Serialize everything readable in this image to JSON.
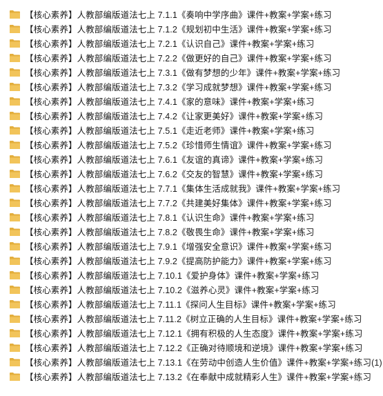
{
  "folder_icon": "folder-icon",
  "folder_color": "#F2C45A",
  "items": [
    "【核心素养】人教部编版道法七上 7.1.1《奏响中学序曲》课件+教案+学案+练习",
    "【核心素养】人教部编版道法七上 7.1.2《规划初中生活》课件+教案+学案+练习",
    "【核心素养】人教部编版道法七上 7.2.1《认识自己》课件+教案+学案+练习",
    "【核心素养】人教部编版道法七上 7.2.2《做更好的自己》课件+教案+学案+练习",
    "【核心素养】人教部编版道法七上 7.3.1《做有梦想的少年》课件+教案+学案+练习",
    "【核心素养】人教部编版道法七上 7.3.2《学习成就梦想》课件+教案+学案+练习",
    "【核心素养】人教部编版道法七上 7.4.1《家的意味》课件+教案+学案+练习",
    "【核心素养】人教部编版道法七上 7.4.2《让家更美好》课件+教案+学案+练习",
    "【核心素养】人教部编版道法七上 7.5.1《走近老师》课件+教案+学案+练习",
    "【核心素养】人教部编版道法七上 7.5.2《珍惜师生情谊》课件+教案+学案+练习",
    "【核心素养】人教部编版道法七上 7.6.1《友谊的真谛》课件+教案+学案+练习",
    "【核心素养】人教部编版道法七上 7.6.2《交友的智慧》课件+教案+学案+练习",
    "【核心素养】人教部编版道法七上 7.7.1《集体生活成就我》课件+教案+学案+练习",
    "【核心素养】人教部编版道法七上 7.7.2《共建美好集体》课件+教案+学案+练习",
    "【核心素养】人教部编版道法七上 7.8.1《认识生命》课件+教案+学案+练习",
    "【核心素养】人教部编版道法七上 7.8.2《敬畏生命》课件+教案+学案+练习",
    "【核心素养】人教部编版道法七上 7.9.1《增强安全意识》课件+教案+学案+练习",
    "【核心素养】人教部编版道法七上 7.9.2《提高防护能力》课件+教案+学案+练习",
    "【核心素养】人教部编版道法七上 7.10.1《爱护身体》课件+教案+学案+练习",
    "【核心素养】人教部编版道法七上 7.10.2《滋养心灵》课件+教案+学案+练习",
    "【核心素养】人教部编版道法七上 7.11.1《探问人生目标》课件+教案+学案+练习",
    "【核心素养】人教部编版道法七上 7.11.2《树立正确的人生目标》课件+教案+学案+练习",
    "【核心素养】人教部编版道法七上 7.12.1《拥有积极的人生态度》课件+教案+学案+练习",
    "【核心素养】人教部编版道法七上 7.12.2《正确对待顺境和逆境》课件+教案+学案+练习",
    "【核心素养】人教部编版道法七上 7.13.1《在劳动中创造人生价值》课件+教案+学案+练习(1)",
    "【核心素养】人教部编版道法七上 7.13.2《在奉献中成就精彩人生》课件+教案+学案+练习"
  ]
}
